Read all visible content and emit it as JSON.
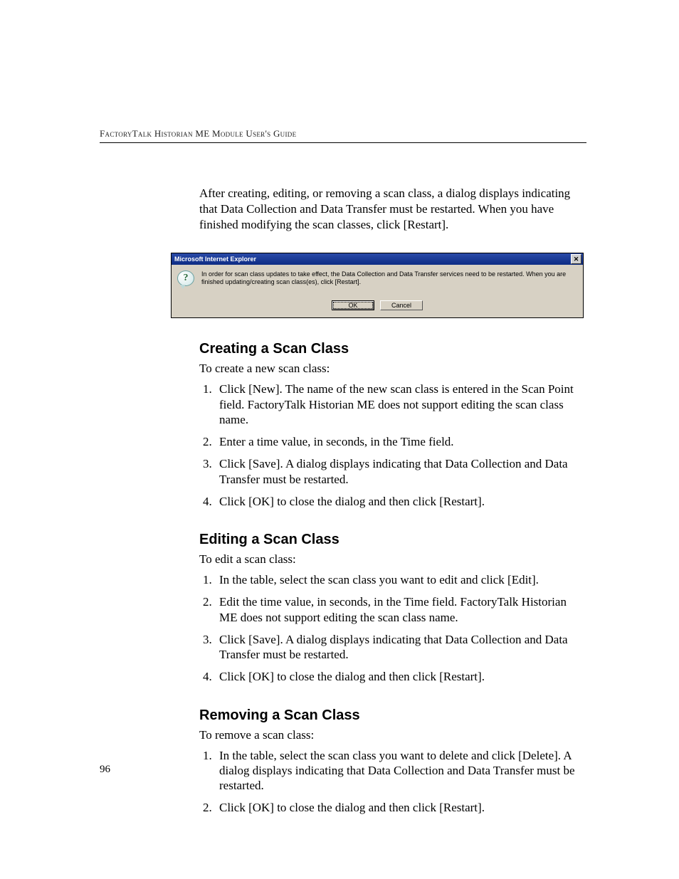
{
  "header": {
    "running_head": "FactoryTalk Historian ME Module User's Guide"
  },
  "intro_paragraph": "After creating, editing, or removing a scan class, a dialog displays indicating that Data Collection and Data Transfer must be restarted. When you have finished modifying the scan classes, click [Restart].",
  "dialog": {
    "title": "Microsoft Internet Explorer",
    "message": "In order for scan class updates to take effect, the Data Collection and Data Transfer services need to be restarted. When you are finished updating/creating scan class(es), click [Restart].",
    "ok_label": "OK",
    "cancel_label": "Cancel",
    "icon_name": "question-icon"
  },
  "sections": {
    "creating": {
      "heading": "Creating a Scan Class",
      "intro": "To create a new scan class:",
      "steps": [
        "Click [New]. The name of the new scan class is entered in the Scan Point field. FactoryTalk Historian ME does not support editing the scan class name.",
        "Enter a time value, in seconds, in the Time field.",
        "Click [Save]. A dialog displays indicating that Data Collection and Data Transfer must be restarted.",
        "Click [OK] to close the dialog and then click [Restart]."
      ]
    },
    "editing": {
      "heading": "Editing a Scan Class",
      "intro": "To edit a scan class:",
      "steps": [
        "In the table, select the scan class you want to edit and click [Edit].",
        "Edit the time value, in seconds, in the Time field. FactoryTalk Historian ME does not support editing the scan class name.",
        "Click [Save]. A dialog displays indicating that Data Collection and Data Transfer must be restarted.",
        "Click [OK] to close the dialog and then click [Restart]."
      ]
    },
    "removing": {
      "heading": "Removing a Scan Class",
      "intro": "To remove a scan class:",
      "steps": [
        "In the table, select the scan class you want to delete and click [Delete]. A dialog displays indicating that Data Collection and Data Transfer must be restarted.",
        "Click [OK] to close the dialog and then click [Restart]."
      ]
    }
  },
  "page_number": "96"
}
